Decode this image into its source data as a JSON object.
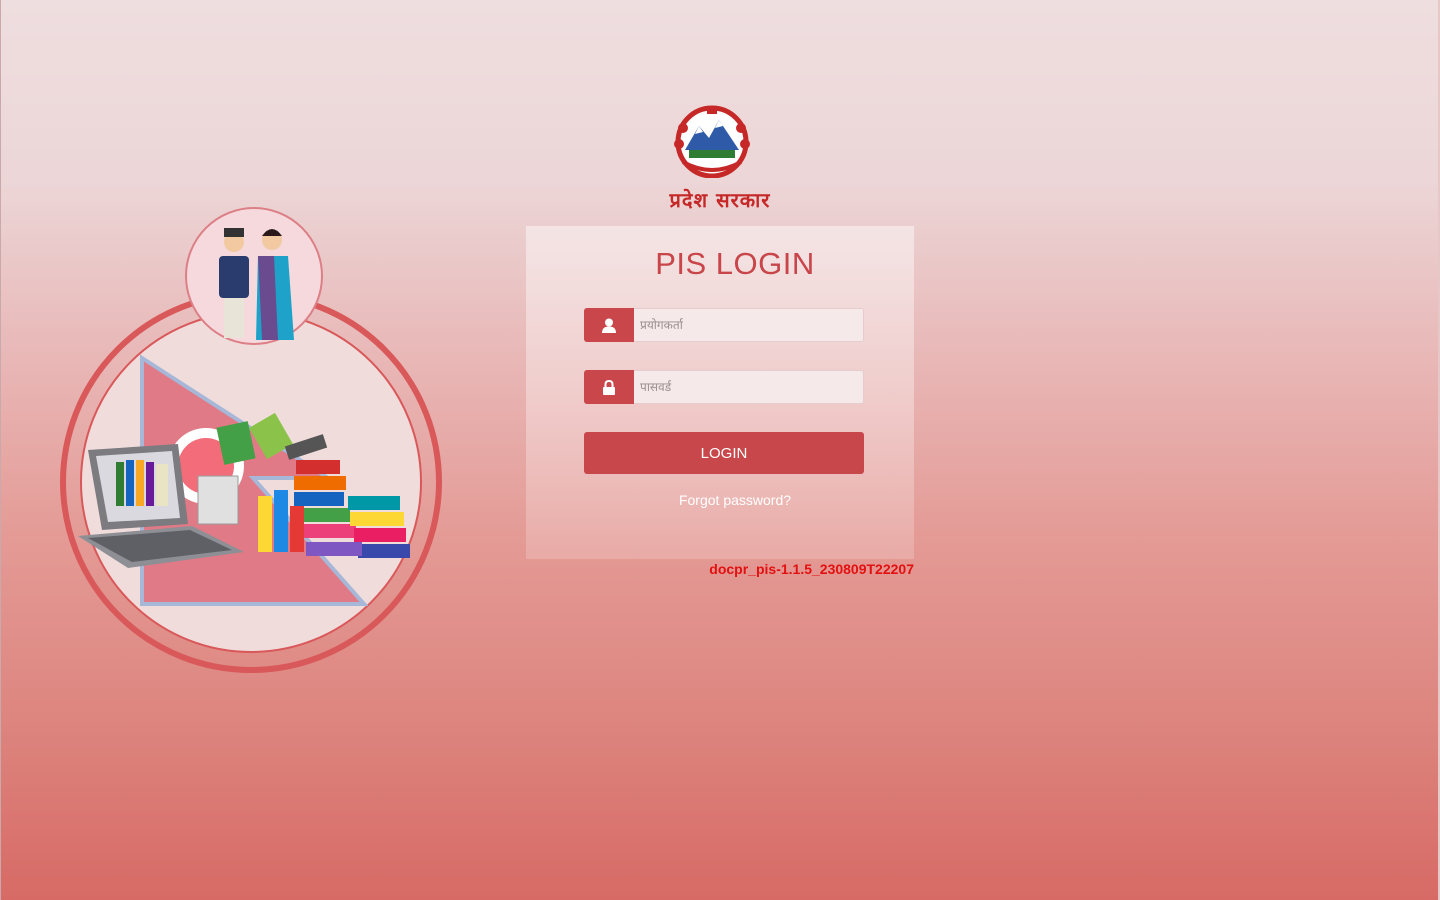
{
  "header": {
    "org_title": "प्रदेश सरकार",
    "emblem_icon": "nepal-emblem-icon"
  },
  "login": {
    "title": "PIS LOGIN",
    "username_placeholder": "प्रयोगकर्ता",
    "password_placeholder": "पासवर्ड",
    "user_icon": "user-icon",
    "lock_icon": "lock-icon",
    "submit_label": "LOGIN",
    "forgot_label": "Forgot password?"
  },
  "footer": {
    "version": "docpr_pis-1.1.5_230809T22207"
  },
  "illustration": {
    "icon": "pis-illustration"
  },
  "colors": {
    "accent": "#c8474a",
    "title_red": "#c62828",
    "version_red": "#e31010"
  }
}
